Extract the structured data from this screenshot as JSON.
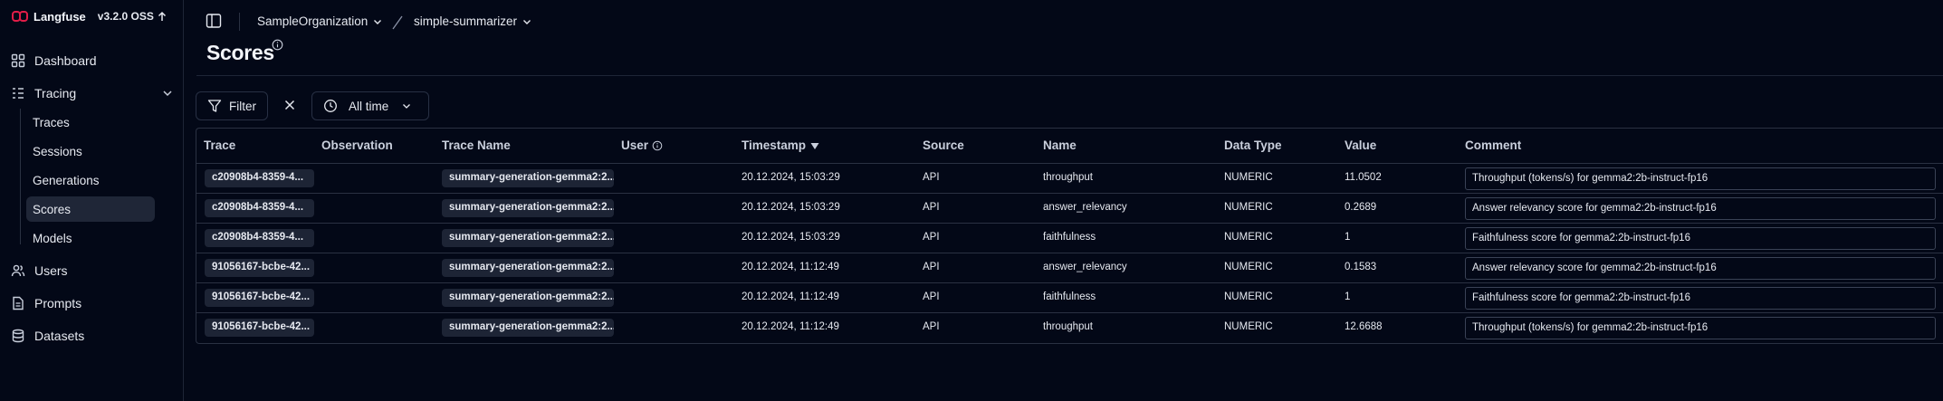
{
  "app": {
    "name": "Langfuse",
    "version": "v3.2.0 OSS",
    "brand_color": "#e11d48"
  },
  "sidebar": {
    "items": [
      {
        "label": "Dashboard",
        "icon": "grid-icon"
      },
      {
        "label": "Tracing",
        "icon": "list-tree-icon"
      },
      {
        "label": "Users",
        "icon": "users-icon"
      },
      {
        "label": "Prompts",
        "icon": "file-text-icon"
      },
      {
        "label": "Datasets",
        "icon": "database-icon"
      }
    ],
    "tracing_children": [
      {
        "label": "Traces"
      },
      {
        "label": "Sessions"
      },
      {
        "label": "Generations"
      },
      {
        "label": "Scores",
        "active": true
      },
      {
        "label": "Models"
      }
    ]
  },
  "breadcrumb": {
    "organization": "SampleOrganization",
    "project": "simple-summarizer"
  },
  "page": {
    "title": "Scores"
  },
  "toolbar": {
    "filter_label": "Filter",
    "time_range": "All time"
  },
  "table": {
    "columns": [
      "Trace",
      "Observation",
      "Trace Name",
      "User",
      "Timestamp",
      "Source",
      "Name",
      "Data Type",
      "Value",
      "Comment"
    ],
    "sort": {
      "column": "Timestamp",
      "direction": "desc"
    },
    "rows": [
      {
        "trace": "c20908b4-8359-4...",
        "observation": "",
        "trace_name": "summary-generation-gemma2:2...",
        "user": "",
        "timestamp": "20.12.2024, 15:03:29",
        "source": "API",
        "name": "throughput",
        "data_type": "NUMERIC",
        "value": "11.0502",
        "comment": "Throughput (tokens/s) for gemma2:2b-instruct-fp16"
      },
      {
        "trace": "c20908b4-8359-4...",
        "observation": "",
        "trace_name": "summary-generation-gemma2:2...",
        "user": "",
        "timestamp": "20.12.2024, 15:03:29",
        "source": "API",
        "name": "answer_relevancy",
        "data_type": "NUMERIC",
        "value": "0.2689",
        "comment": "Answer relevancy score for gemma2:2b-instruct-fp16"
      },
      {
        "trace": "c20908b4-8359-4...",
        "observation": "",
        "trace_name": "summary-generation-gemma2:2...",
        "user": "",
        "timestamp": "20.12.2024, 15:03:29",
        "source": "API",
        "name": "faithfulness",
        "data_type": "NUMERIC",
        "value": "1",
        "comment": "Faithfulness score for gemma2:2b-instruct-fp16"
      },
      {
        "trace": "91056167-bcbe-42...",
        "observation": "",
        "trace_name": "summary-generation-gemma2:2...",
        "user": "",
        "timestamp": "20.12.2024, 11:12:49",
        "source": "API",
        "name": "answer_relevancy",
        "data_type": "NUMERIC",
        "value": "0.1583",
        "comment": "Answer relevancy score for gemma2:2b-instruct-fp16"
      },
      {
        "trace": "91056167-bcbe-42...",
        "observation": "",
        "trace_name": "summary-generation-gemma2:2...",
        "user": "",
        "timestamp": "20.12.2024, 11:12:49",
        "source": "API",
        "name": "faithfulness",
        "data_type": "NUMERIC",
        "value": "1",
        "comment": "Faithfulness score for gemma2:2b-instruct-fp16"
      },
      {
        "trace": "91056167-bcbe-42...",
        "observation": "",
        "trace_name": "summary-generation-gemma2:2...",
        "user": "",
        "timestamp": "20.12.2024, 11:12:49",
        "source": "API",
        "name": "throughput",
        "data_type": "NUMERIC",
        "value": "12.6688",
        "comment": "Throughput (tokens/s) for gemma2:2b-instruct-fp16"
      }
    ]
  }
}
